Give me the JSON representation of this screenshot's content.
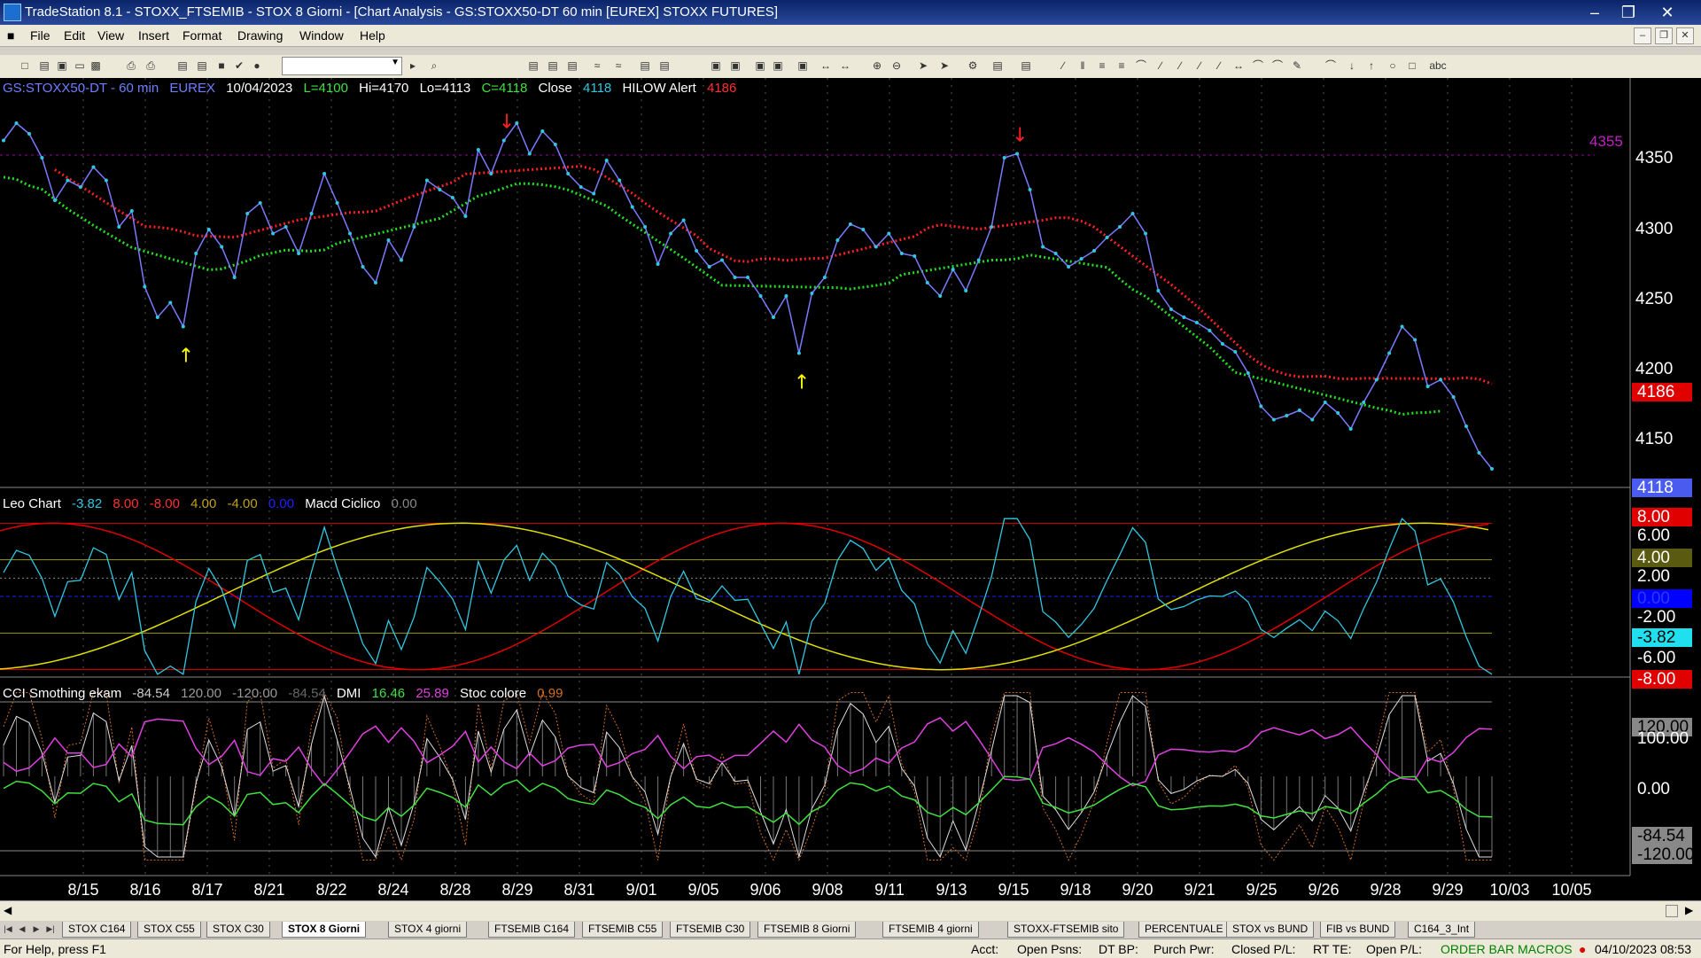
{
  "window": {
    "title": "TradeStation 8.1 - STOXX_FTSEMIB - STOX  8 Giorni - [Chart Analysis - GS:STOXX50-DT  60 min  [EUREX] STOXX FUTURES]"
  },
  "menu": [
    "File",
    "Edit",
    "View",
    "Insert",
    "Format",
    "Drawing",
    "Window",
    "Help"
  ],
  "price_panel": {
    "symbol": "GS:STOXX50-DT - 60 min",
    "exchange": "EUREX",
    "date": "10/04/2023",
    "low": "L=4100",
    "high": "Hi=4170",
    "lo": "Lo=4113",
    "close_val": "C=4118",
    "close_label": "Close",
    "close_num": "4118",
    "indicator": "HILOW Alert",
    "indicator_val": "4186",
    "level_label": "4355",
    "y_ticks": [
      "4350",
      "4300",
      "4250",
      "4200",
      "4150"
    ],
    "last_tag": "4118",
    "alert_tag": "4186"
  },
  "osc_panel": {
    "name": "Leo Chart",
    "v1": "-3.82",
    "v2": "8.00",
    "v3": "-8.00",
    "v4": "4.00",
    "v5": "-4.00",
    "v6": "0.00",
    "name2": "Macd Ciclico",
    "v7": "0.00",
    "ticks": [
      "6.00",
      "2.00",
      "-2.00",
      "-6.00"
    ],
    "tags": {
      "top": "8.00",
      "upper": "4.00",
      "zero": "0.00",
      "cur": "-3.82",
      "bottom": "-8.00"
    }
  },
  "cci_panel": {
    "name": "CCI Smothing ekam",
    "v1": "-84.54",
    "v2": "120.00",
    "v3": "-120.00",
    "v4": "-84.54",
    "name2": "DMI",
    "dmi1": "16.46",
    "dmi2": "25.89",
    "name3": "Stoc colore",
    "stoc": "0.99",
    "ticks": [
      "100.00",
      "0.00"
    ],
    "tags": {
      "top": "120.00",
      "cur": "-84.54",
      "bottom": "-120.00"
    }
  },
  "x_axis": [
    "8/15",
    "8/16",
    "8/17",
    "8/21",
    "8/22",
    "8/24",
    "8/28",
    "8/29",
    "8/31",
    "9/01",
    "9/05",
    "9/06",
    "9/08",
    "9/11",
    "9/13",
    "9/15",
    "9/18",
    "9/20",
    "9/21",
    "9/25",
    "9/26",
    "9/28",
    "9/29",
    "10/03",
    "10/05"
  ],
  "tabs": [
    "STOX C164",
    "STOX C55",
    "STOX  C30",
    "STOX  8 Giorni",
    "STOX 4 giorni",
    "FTSEMIB C164",
    "FTSEMIB C55",
    "FTSEMIB C30",
    "FTSEMIB  8 Giorni",
    "FTSEMIB  4 giorni",
    "STOXX-FTSEMIB sito",
    "PERCENTUALE",
    "STOX vs BUND",
    "FIB vs BUND",
    "C164_3_Int"
  ],
  "active_tab": 3,
  "status": {
    "help": "For Help, press F1",
    "acct": "Acct:",
    "open_psns": "Open Psns:",
    "dt_bp": "DT BP:",
    "purch_pwr": "Purch Pwr:",
    "closed_pl": "Closed P/L:",
    "rt_te": "RT TE:",
    "open_pl": "Open P/L:",
    "macros": "ORDER BAR  MACROS",
    "datetime": "04/10/2023 08:53"
  },
  "chart_data": {
    "type": "line",
    "price_series": [
      4365,
      4378,
      4370,
      4352,
      4320,
      4335,
      4330,
      4345,
      4335,
      4300,
      4312,
      4255,
      4232,
      4243,
      4225,
      4280,
      4298,
      4285,
      4262,
      4310,
      4318,
      4295,
      4300,
      4280,
      4310,
      4340,
      4318,
      4295,
      4270,
      4258,
      4290,
      4275,
      4300,
      4335,
      4328,
      4322,
      4308,
      4358,
      4340,
      4365,
      4378,
      4355,
      4372,
      4362,
      4340,
      4330,
      4325,
      4350,
      4335,
      4315,
      4300,
      4272,
      4295,
      4305,
      4282,
      4270,
      4275,
      4262,
      4262,
      4248,
      4232,
      4248,
      4205,
      4250,
      4262,
      4290,
      4302,
      4298,
      4285,
      4295,
      4280,
      4278,
      4258,
      4248,
      4268,
      4252,
      4275,
      4300,
      4352,
      4355,
      4328,
      4285,
      4280,
      4270,
      4276,
      4282,
      4292,
      4300,
      4310,
      4295,
      4252,
      4238,
      4232,
      4228,
      4222,
      4212,
      4206,
      4190,
      4165,
      4155,
      4158,
      4162,
      4155,
      4168,
      4160,
      4148,
      4168,
      4185,
      4205,
      4225,
      4215,
      4180,
      4185,
      4172,
      4150,
      4130,
      4118
    ],
    "hilow_line_color": "#ff2020",
    "hilow_support_color": "#20e020",
    "price_color": "#30c8e0"
  }
}
